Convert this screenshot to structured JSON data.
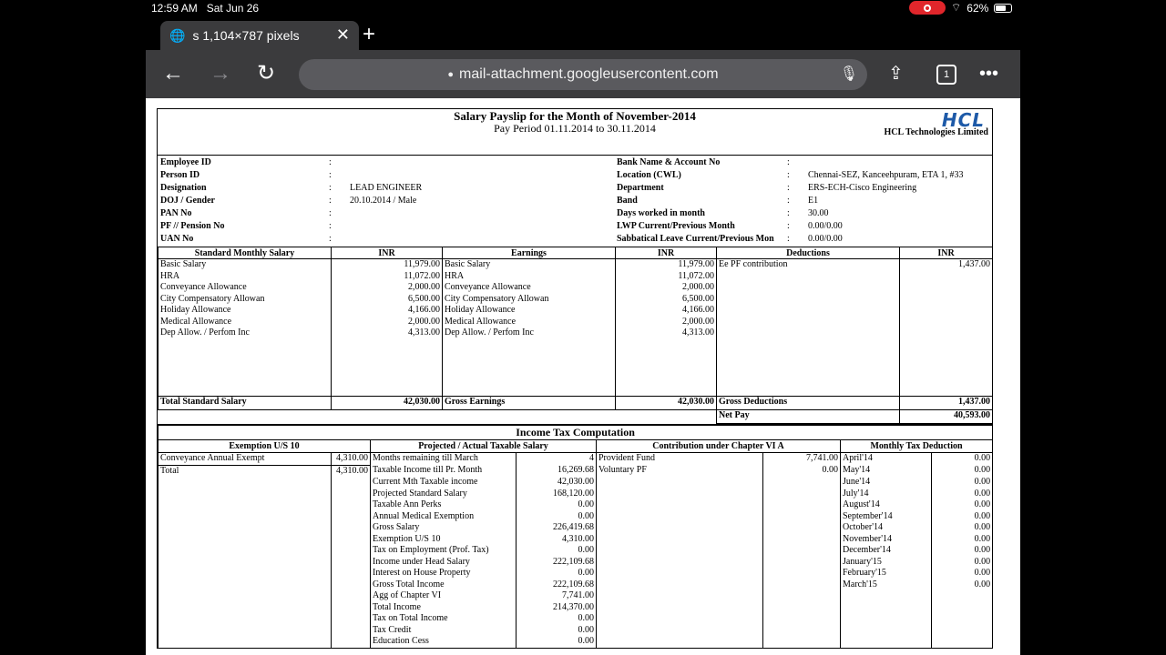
{
  "status": {
    "time": "12:59 AM",
    "date": "Sat Jun 26",
    "battery": "62%"
  },
  "tab": {
    "title": "s 1,104×787 pixels"
  },
  "url": "mail-attachment.googleusercontent.com",
  "tab_count": "1",
  "slip": {
    "title": "Salary Payslip for the Month of November-2014",
    "period": "Pay Period 01.11.2014 to 30.11.2014",
    "company": "HCL Technologies Limited",
    "logo": "HCL",
    "left_fields": [
      {
        "label": "Employee ID",
        "value": ""
      },
      {
        "label": "Person ID",
        "value": ""
      },
      {
        "label": "Designation",
        "value": "LEAD ENGINEER"
      },
      {
        "label": "DOJ / Gender",
        "value": "20.10.2014 / Male"
      },
      {
        "label": "PAN No",
        "value": ""
      },
      {
        "label": "PF // Pension No",
        "value": ""
      },
      {
        "label": "UAN No",
        "value": ""
      }
    ],
    "right_fields": [
      {
        "label": "Bank Name & Account No",
        "value": ""
      },
      {
        "label": "Location (CWL)",
        "value": "Chennai-SEZ, Kanceehpuram, ETA 1, #33"
      },
      {
        "label": "Department",
        "value": "ERS-ECH-Cisco Engineering"
      },
      {
        "label": "Band",
        "value": "E1"
      },
      {
        "label": "Days worked in month",
        "value": "30.00"
      },
      {
        "label": "LWP Current/Previous Month",
        "value": "0.00/0.00"
      },
      {
        "label": "Sabbatical Leave Current/Previous Mon",
        "value": "0.00/0.00"
      }
    ],
    "salary_headers": [
      "Standard Monthly Salary",
      "INR",
      "Earnings",
      "INR",
      "Deductions",
      "INR"
    ],
    "salary_rows": [
      [
        "Basic Salary",
        "11,979.00",
        "Basic Salary",
        "11,979.00",
        "Ee PF contribution",
        "1,437.00"
      ],
      [
        "HRA",
        "11,072.00",
        "HRA",
        "11,072.00",
        "",
        ""
      ],
      [
        "Conveyance Allowance",
        "2,000.00",
        "Conveyance Allowance",
        "2,000.00",
        "",
        ""
      ],
      [
        "City Compensatory Allowan",
        "6,500.00",
        "City Compensatory Allowan",
        "6,500.00",
        "",
        ""
      ],
      [
        "Holiday Allowance",
        "4,166.00",
        "Holiday Allowance",
        "4,166.00",
        "",
        ""
      ],
      [
        "Medical Allowance",
        "2,000.00",
        "Medical Allowance",
        "2,000.00",
        "",
        ""
      ],
      [
        "Dep Allow. / Perfom Inc",
        "4,313.00",
        "Dep Allow. / Perfom Inc",
        "4,313.00",
        "",
        ""
      ]
    ],
    "totals": [
      "Total Standard Salary",
      "42,030.00",
      "Gross Earnings",
      "42,030.00",
      "Gross Deductions",
      "1,437.00"
    ],
    "net_pay": {
      "label": "Net Pay",
      "value": "40,593.00"
    },
    "itc_title": "Income Tax Computation",
    "itc_headers": [
      "Exemption U/S 10",
      "Projected / Actual Taxable Salary",
      "Contribution under Chapter VI A",
      "Monthly Tax Deduction"
    ],
    "exemptions": [
      [
        "Conveyance Annual Exempt",
        "4,310.00"
      ],
      [
        "Total",
        "4,310.00"
      ]
    ],
    "taxable": [
      [
        "Months remaining till March",
        "4"
      ],
      [
        "Taxable Income till Pr. Month",
        "16,269.68"
      ],
      [
        "Current Mth Taxable income",
        "42,030.00"
      ],
      [
        "Projected Standard Salary",
        "168,120.00"
      ],
      [
        "Taxable Ann Perks",
        "0.00"
      ],
      [
        "Annual Medical Exemption",
        "0.00"
      ],
      [
        "Gross Salary",
        "226,419.68"
      ],
      [
        "Exemption U/S 10",
        "4,310.00"
      ],
      [
        "Tax on Employment (Prof. Tax)",
        "0.00"
      ],
      [
        "Income under Head Salary",
        "222,109.68"
      ],
      [
        "Interest on House Property",
        "0.00"
      ],
      [
        "Gross Total Income",
        "222,109.68"
      ],
      [
        "Agg of Chapter VI",
        "7,741.00"
      ],
      [
        "Total Income",
        "214,370.00"
      ],
      [
        "Tax on Total Income",
        "0.00"
      ],
      [
        "Tax Credit",
        "0.00"
      ],
      [
        "Education Cess",
        "0.00"
      ]
    ],
    "contributions": [
      [
        "Provident Fund",
        "7,741.00"
      ],
      [
        "Voluntary PF",
        "0.00"
      ]
    ],
    "monthly_tax": [
      [
        "April'14",
        "0.00"
      ],
      [
        "May'14",
        "0.00"
      ],
      [
        "June'14",
        "0.00"
      ],
      [
        "July'14",
        "0.00"
      ],
      [
        "August'14",
        "0.00"
      ],
      [
        "September'14",
        "0.00"
      ],
      [
        "October'14",
        "0.00"
      ],
      [
        "November'14",
        "0.00"
      ],
      [
        "December'14",
        "0.00"
      ],
      [
        "January'15",
        "0.00"
      ],
      [
        "February'15",
        "0.00"
      ],
      [
        "March'15",
        "0.00"
      ]
    ]
  }
}
